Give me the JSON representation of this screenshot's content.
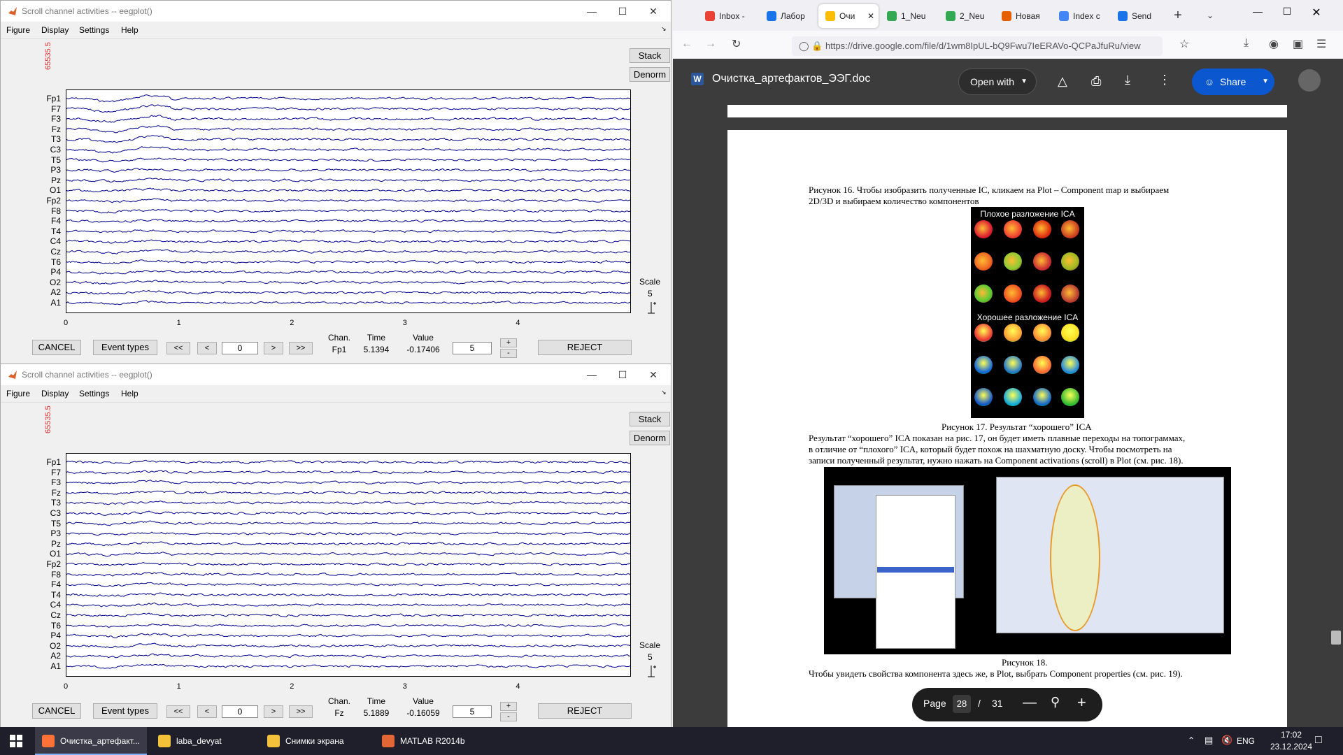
{
  "matlab_windows": [
    {
      "title": "Scroll channel activities -- eegplot()",
      "menu": [
        "Figure",
        "Display",
        "Settings",
        "Help"
      ],
      "scale_value_top": "65535.5",
      "channels": [
        "Fp1",
        "F7",
        "F3",
        "Fz",
        "T3",
        "C3",
        "T5",
        "P3",
        "Pz",
        "O1",
        "Fp2",
        "F8",
        "F4",
        "T4",
        "C4",
        "Cz",
        "T6",
        "P4",
        "O2",
        "A2",
        "A1"
      ],
      "x_ticks": [
        "0",
        "1",
        "2",
        "3",
        "4"
      ],
      "buttons": {
        "stack": "Stack",
        "denorm": "Denorm",
        "cancel": "CANCEL",
        "event_types": "Event types",
        "first": "<<",
        "prev": "<",
        "next": ">",
        "last": ">>",
        "plus": "+",
        "minus": "-",
        "reject": "REJECT"
      },
      "position_value": "0",
      "readout": {
        "chan_label": "Chan.",
        "time_label": "Time",
        "value_label": "Value",
        "chan": "Fp1",
        "time": "5.1394",
        "value": "-0.17406"
      },
      "spacing_value": "5",
      "scale_label": "Scale",
      "scale_number": "5"
    },
    {
      "title": "Scroll channel activities -- eegplot()",
      "menu": [
        "Figure",
        "Display",
        "Settings",
        "Help"
      ],
      "scale_value_top": "65535.5",
      "channels": [
        "Fp1",
        "F7",
        "F3",
        "Fz",
        "T3",
        "C3",
        "T5",
        "P3",
        "Pz",
        "O1",
        "Fp2",
        "F8",
        "F4",
        "T4",
        "C4",
        "Cz",
        "T6",
        "P4",
        "O2",
        "A2",
        "A1"
      ],
      "x_ticks": [
        "0",
        "1",
        "2",
        "3",
        "4"
      ],
      "buttons": {
        "stack": "Stack",
        "denorm": "Denorm",
        "cancel": "CANCEL",
        "event_types": "Event types",
        "first": "<<",
        "prev": "<",
        "next": ">",
        "last": ">>",
        "plus": "+",
        "minus": "-",
        "reject": "REJECT"
      },
      "position_value": "0",
      "readout": {
        "chan_label": "Chan.",
        "time_label": "Time",
        "value_label": "Value",
        "chan": "Fz",
        "time": "5.1889",
        "value": "-0.16059"
      },
      "spacing_value": "5",
      "scale_label": "Scale",
      "scale_number": "5"
    }
  ],
  "browser": {
    "tabs": [
      {
        "label": "Inbox -",
        "icon_color": "#ea4335"
      },
      {
        "label": "Лабор",
        "icon_color": "#1a73e8"
      },
      {
        "label": "Очи",
        "icon_color": "#fbbc04"
      },
      {
        "label": "1_Neu",
        "icon_color": "#34a853"
      },
      {
        "label": "2_Neu",
        "icon_color": "#34a853"
      },
      {
        "label": "Новая",
        "icon_color": "#e66000"
      },
      {
        "label": "Index c",
        "icon_color": "#4285f4"
      },
      {
        "label": "Send",
        "icon_color": "#1a73e8"
      }
    ],
    "url": "https://drive.google.com/file/d/1wm8IpUL-bQ9Fwu7IeERAVo-QCPaJfuRu/view",
    "doc_title": "Очистка_артефактов_ЭЭГ.doc",
    "open_with": "Open with",
    "share": "Share",
    "doc_text": {
      "fig16_caption_line1": "Рисунок 16. Чтобы изобразить полученные IC, кликаем на Plot – Component map и выбираем",
      "fig16_caption_line2": "2D/3D и выбираем количество компонентов",
      "bad_ica": "Плохое разложение ICA",
      "good_ica": "Хорошее разложение ICA",
      "fig17_caption": "Рисунок 17. Результат “хорошего” ICA",
      "para1_line1": "Результат “хорошего” ICA показан на рис. 17, он будет иметь плавные переходы на топограммах,",
      "para1_line2": "в отличие от “плохого” ICA, который будет похож на шахматную доску.  Чтобы посмотреть на",
      "para1_line3": "записи полученный результат, нужно нажать на Component activations (scroll) в Plot (см. рис. 18).",
      "fig18_caption": "Рисунок 18.",
      "para2": "Чтобы увидеть свойства компонента здесь же, в Plot, выбрать Component properties (см. рис. 19)."
    },
    "page_bar": {
      "label": "Page",
      "current": "28",
      "sep": "/",
      "total": "31"
    }
  },
  "taskbar": {
    "items": [
      {
        "label": "Очистка_артефакт...",
        "icon_color": "#ff7139"
      },
      {
        "label": "laba_devyat",
        "icon_color": "#f3c13a"
      },
      {
        "label": "Снимки экрана",
        "icon_color": "#f3c13a"
      },
      {
        "label": "MATLAB R2014b",
        "icon_color": "#e16737"
      }
    ],
    "lang": "ENG",
    "time": "17:02",
    "date": "23.12.2024"
  }
}
